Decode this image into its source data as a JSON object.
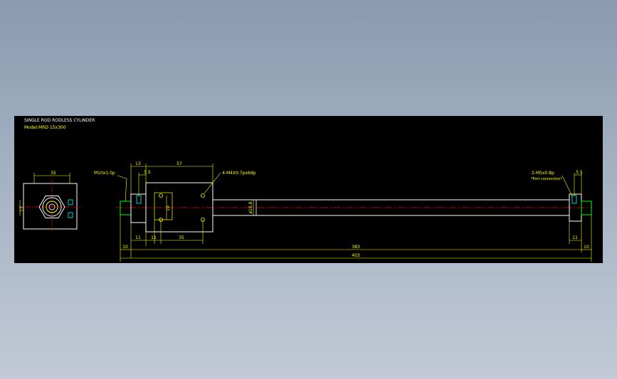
{
  "colors": {
    "viewport_bg": "#000000",
    "outline": "#ffffff",
    "dimension": "#ffff00",
    "centerline": "#ff0000",
    "port": "#00ff00",
    "thread": "#00ffff",
    "title_text": "#ffffff",
    "model_text": "#ffff00"
  },
  "title": {
    "line1": "SINGLE ROD RODLESS CYLINDER",
    "line2": "Model:MRD 15x300"
  },
  "end_view": {
    "width_dim": "35",
    "height_dim": "17"
  },
  "side_view": {
    "dims": {
      "port_thread": "M10x1.0p",
      "end_block": "13",
      "port_offset_left": "5.5",
      "carriage_length": "57",
      "mount_thread": "4-M4X0.7px6dp",
      "hole_pitch_v": "19",
      "hole_pitch_h": "35",
      "hole_offset": "11",
      "rod_dia": "ø16.8",
      "left_block": "11",
      "right_block": "11",
      "left_stub": "10",
      "right_stub": "10",
      "span": "383",
      "overall": "403",
      "port_thread_right": "2-M5x0.8p",
      "port_connection_note": "*Port connection*",
      "port_offset_right": "5.5"
    }
  }
}
